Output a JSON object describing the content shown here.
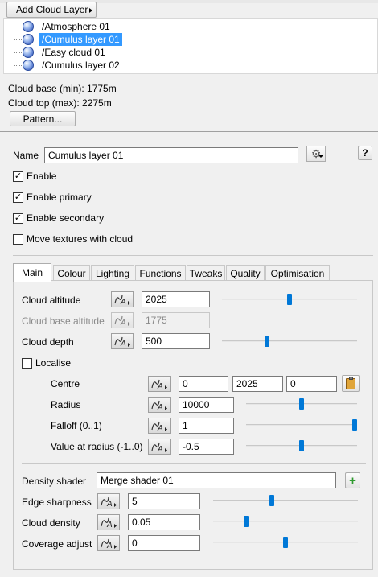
{
  "toolbar": {
    "add_cloud_layer_label": "Add Cloud Layer"
  },
  "tree": {
    "items": [
      {
        "label": "/Atmosphere 01",
        "selected": false
      },
      {
        "label": "/Cumulus layer 01",
        "selected": true
      },
      {
        "label": "/Easy cloud 01",
        "selected": false
      },
      {
        "label": "/Cumulus layer 02",
        "selected": false
      }
    ]
  },
  "info": {
    "cloud_base": "Cloud base (min): 1775m",
    "cloud_top": "Cloud top (max): 2275m",
    "pattern_label": "Pattern..."
  },
  "props": {
    "name_label": "Name",
    "name_value": "Cumulus layer 01",
    "help_label": "?",
    "enable_label": "Enable",
    "enable_checked": true,
    "enable_primary_label": "Enable primary",
    "enable_primary_checked": true,
    "enable_secondary_label": "Enable secondary",
    "enable_secondary_checked": true,
    "move_textures_label": "Move textures with cloud",
    "move_textures_checked": false
  },
  "tabs": [
    "Main",
    "Colour",
    "Lighting",
    "Functions",
    "Tweaks",
    "Quality",
    "Optimisation"
  ],
  "main": {
    "cloud_altitude": {
      "label": "Cloud altitude",
      "value": "2025",
      "slider": 0.5
    },
    "cloud_base_altitude": {
      "label": "Cloud base altitude",
      "value": "1775"
    },
    "cloud_depth": {
      "label": "Cloud depth",
      "value": "500",
      "slider": 0.33
    },
    "localise": {
      "label": "Localise",
      "checked": false
    },
    "centre": {
      "label": "Centre",
      "x": "0",
      "y": "2025",
      "z": "0"
    },
    "radius": {
      "label": "Radius",
      "value": "10000",
      "slider": 0.5
    },
    "falloff": {
      "label": "Falloff (0..1)",
      "value": "1",
      "slider": 1.0
    },
    "value_at_radius": {
      "label": "Value at radius (-1..0)",
      "value": "-0.5",
      "slider": 0.5
    },
    "density_shader": {
      "label": "Density shader",
      "value": "Merge shader 01"
    },
    "edge_sharpness": {
      "label": "Edge sharpness",
      "value": "5",
      "slider": 0.4
    },
    "cloud_density": {
      "label": "Cloud density",
      "value": "0.05",
      "slider": 0.22
    },
    "coverage_adjust": {
      "label": "Coverage adjust",
      "value": "0",
      "slider": 0.5
    }
  },
  "colors": {
    "accent": "#0078d7",
    "selection": "#3399ff",
    "plus_green": "#2e9a2e"
  }
}
